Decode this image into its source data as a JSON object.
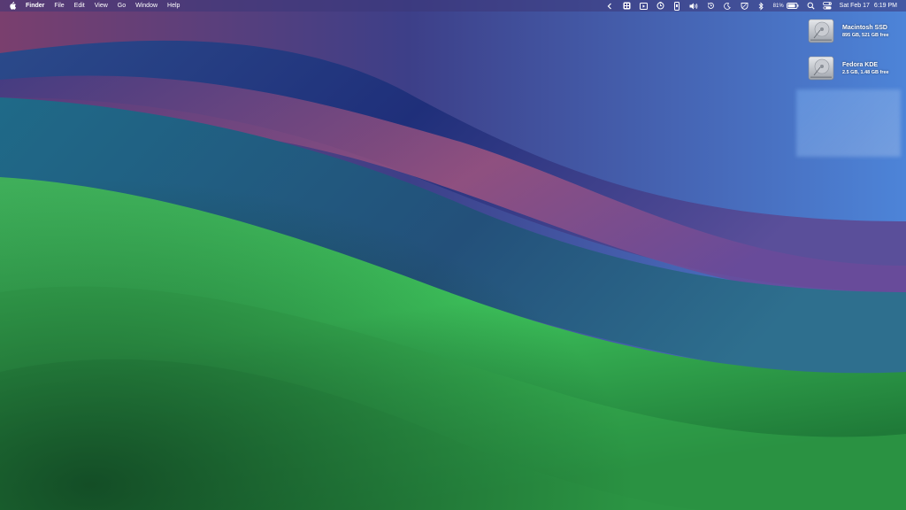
{
  "menubar": {
    "app_name": "Finder",
    "menus": [
      "File",
      "Edit",
      "View",
      "Go",
      "Window",
      "Help"
    ],
    "status_icons": [
      "chevron-left-icon",
      "app-grid-icon",
      "screen-share-icon",
      "clock-outline-icon",
      "phone-icon",
      "volume-icon",
      "history-icon",
      "moon-icon",
      "shield-icon",
      "bluetooth-icon",
      "battery-icon",
      "search-icon",
      "control-center-icon"
    ],
    "battery_percent": "81%",
    "date": "Sat Feb 17",
    "time": "6:19 PM"
  },
  "desktop": {
    "drives": [
      {
        "name": "Macintosh SSD",
        "info": "895 GB, 521 GB free"
      },
      {
        "name": "Fedora KDE",
        "info": "2.5 GB, 1.48 GB free"
      }
    ]
  }
}
